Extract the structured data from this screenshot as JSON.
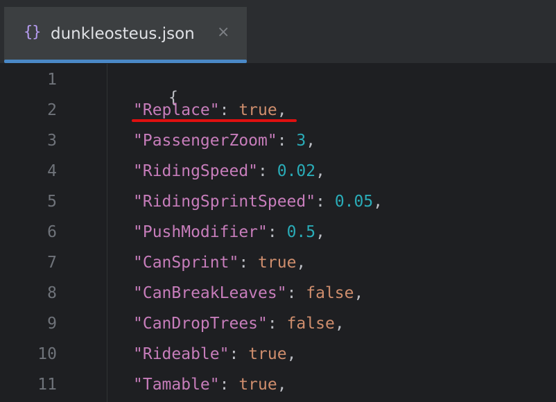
{
  "tab": {
    "icon": "json-braces-icon",
    "icon_glyph": "{}",
    "title": "dunkleosteus.json",
    "close_glyph": "×"
  },
  "colors": {
    "accent": "#4a88c7",
    "key": "#c77dbb",
    "bool": "#cf8e6d",
    "number": "#2aacb8",
    "annotation": "#e01010"
  },
  "gutter": {
    "line_numbers": [
      "1",
      "2",
      "3",
      "4",
      "5",
      "6",
      "7",
      "8",
      "9",
      "10",
      "11"
    ]
  },
  "code": {
    "lines": [
      {
        "open": "{"
      },
      {
        "key": "\"Replace\"",
        "sep": ": ",
        "value": "true",
        "value_type": "bool",
        "end": ","
      },
      {
        "key": "\"PassengerZoom\"",
        "sep": ": ",
        "value": "3",
        "value_type": "number",
        "end": ","
      },
      {
        "key": "\"RidingSpeed\"",
        "sep": ": ",
        "value": "0.02",
        "value_type": "number",
        "end": ","
      },
      {
        "key": "\"RidingSprintSpeed\"",
        "sep": ": ",
        "value": "0.05",
        "value_type": "number",
        "end": ","
      },
      {
        "key": "\"PushModifier\"",
        "sep": ": ",
        "value": "0.5",
        "value_type": "number",
        "end": ","
      },
      {
        "key": "\"CanSprint\"",
        "sep": ": ",
        "value": "true",
        "value_type": "bool",
        "end": ","
      },
      {
        "key": "\"CanBreakLeaves\"",
        "sep": ": ",
        "value": "false",
        "value_type": "bool",
        "end": ","
      },
      {
        "key": "\"CanDropTrees\"",
        "sep": ": ",
        "value": "false",
        "value_type": "bool",
        "end": ","
      },
      {
        "key": "\"Rideable\"",
        "sep": ": ",
        "value": "true",
        "value_type": "bool",
        "end": ","
      },
      {
        "key": "\"Tamable\"",
        "sep": ": ",
        "value": "true",
        "value_type": "bool",
        "end": ","
      }
    ]
  }
}
